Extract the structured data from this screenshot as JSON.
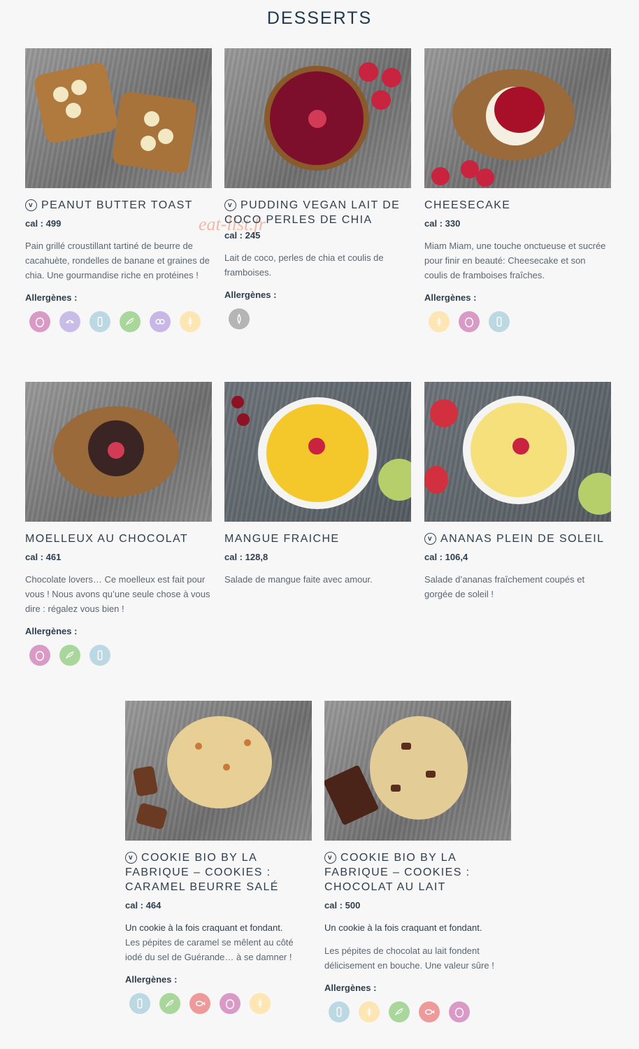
{
  "page": {
    "title": "DESSERTS",
    "watermark": "eat-list.fr"
  },
  "colors": {
    "egg": "#d99ac6",
    "soy": "#c9bde8",
    "milk": "#bcd8e2",
    "peanut": "#a9d69a",
    "nuts": "#c8b7e6",
    "gluten": "#fde6b3",
    "sesame": "#b5b5b5",
    "fish": "#ef9a9a"
  },
  "products": [
    {
      "name": "PEANUT BUTTER TOAST",
      "vegan": true,
      "vegan_mark": "v",
      "cal_label": "cal :",
      "cal": "499",
      "description": "Pain grillé croustillant tartiné de beurre de cacahuète, rondelles de banane et graines de chia. Une gourmandise riche en protéines !",
      "allergens_label": "Allergènes :",
      "allergens": [
        "egg",
        "soy",
        "milk",
        "peanut",
        "nuts",
        "gluten"
      ]
    },
    {
      "name": "PUDDING VEGAN LAIT DE COCO PERLES DE CHIA",
      "vegan": true,
      "vegan_mark": "v",
      "cal_label": "cal :",
      "cal": "245",
      "description": "Lait de coco, perles de chia et coulis de framboises.",
      "allergens_label": "Allergènes :",
      "allergens": [
        "sesame"
      ]
    },
    {
      "name": "CHEESECAKE",
      "vegan": false,
      "cal_label": "cal :",
      "cal": "330",
      "description": "Miam Miam, une touche onctueuse et sucrée pour finir en beauté: Cheesecake et son coulis de framboises fraîches.",
      "allergens_label": "Allergènes :",
      "allergens": [
        "gluten",
        "egg",
        "milk"
      ]
    },
    {
      "name": "MOELLEUX AU CHOCOLAT",
      "vegan": false,
      "cal_label": "cal :",
      "cal": "461",
      "description": "Chocolate lovers… Ce moelleux est fait pour vous ! Nous avons qu’une seule chose à vous dire : régalez vous bien !",
      "allergens_label": "Allergènes :",
      "allergens": [
        "egg",
        "peanut",
        "milk"
      ]
    },
    {
      "name": "MANGUE FRAICHE",
      "vegan": false,
      "cal_label": "cal :",
      "cal": "128,8",
      "description": "Salade de mangue faite avec amour."
    },
    {
      "name": "ANANAS PLEIN DE SOLEIL",
      "vegan": true,
      "vegan_mark": "v",
      "cal_label": "cal :",
      "cal": "106,4",
      "description": "Salade d’ananas fraîchement coupés et gorgée de soleil !"
    },
    {
      "name": "COOKIE BIO BY LA FABRIQUE – COOKIES : CARAMEL BEURRE SALÉ",
      "vegan": true,
      "vegan_mark": "v",
      "cal_label": "cal :",
      "cal": "464",
      "description_strong": "Un cookie à la fois craquant et fondant.",
      "description": "Les pépites de caramel se mêlent au côté iodé du sel de Guérande… à se damner !",
      "allergens_label": "Allergènes :",
      "allergens": [
        "milk",
        "peanut",
        "fish",
        "egg",
        "gluten"
      ]
    },
    {
      "name": "COOKIE BIO BY LA FABRIQUE – COOKIES : CHOCOLAT AU LAIT",
      "vegan": true,
      "vegan_mark": "v",
      "cal_label": "cal :",
      "cal": "500",
      "description_strong": "Un cookie à la fois craquant et fondant.",
      "description": "Les pépites de chocolat au lait fondent délicisement en bouche. Une valeur sûre !",
      "allergens_label": "Allergènes :",
      "allergens": [
        "milk",
        "gluten",
        "peanut",
        "fish",
        "egg"
      ]
    }
  ]
}
